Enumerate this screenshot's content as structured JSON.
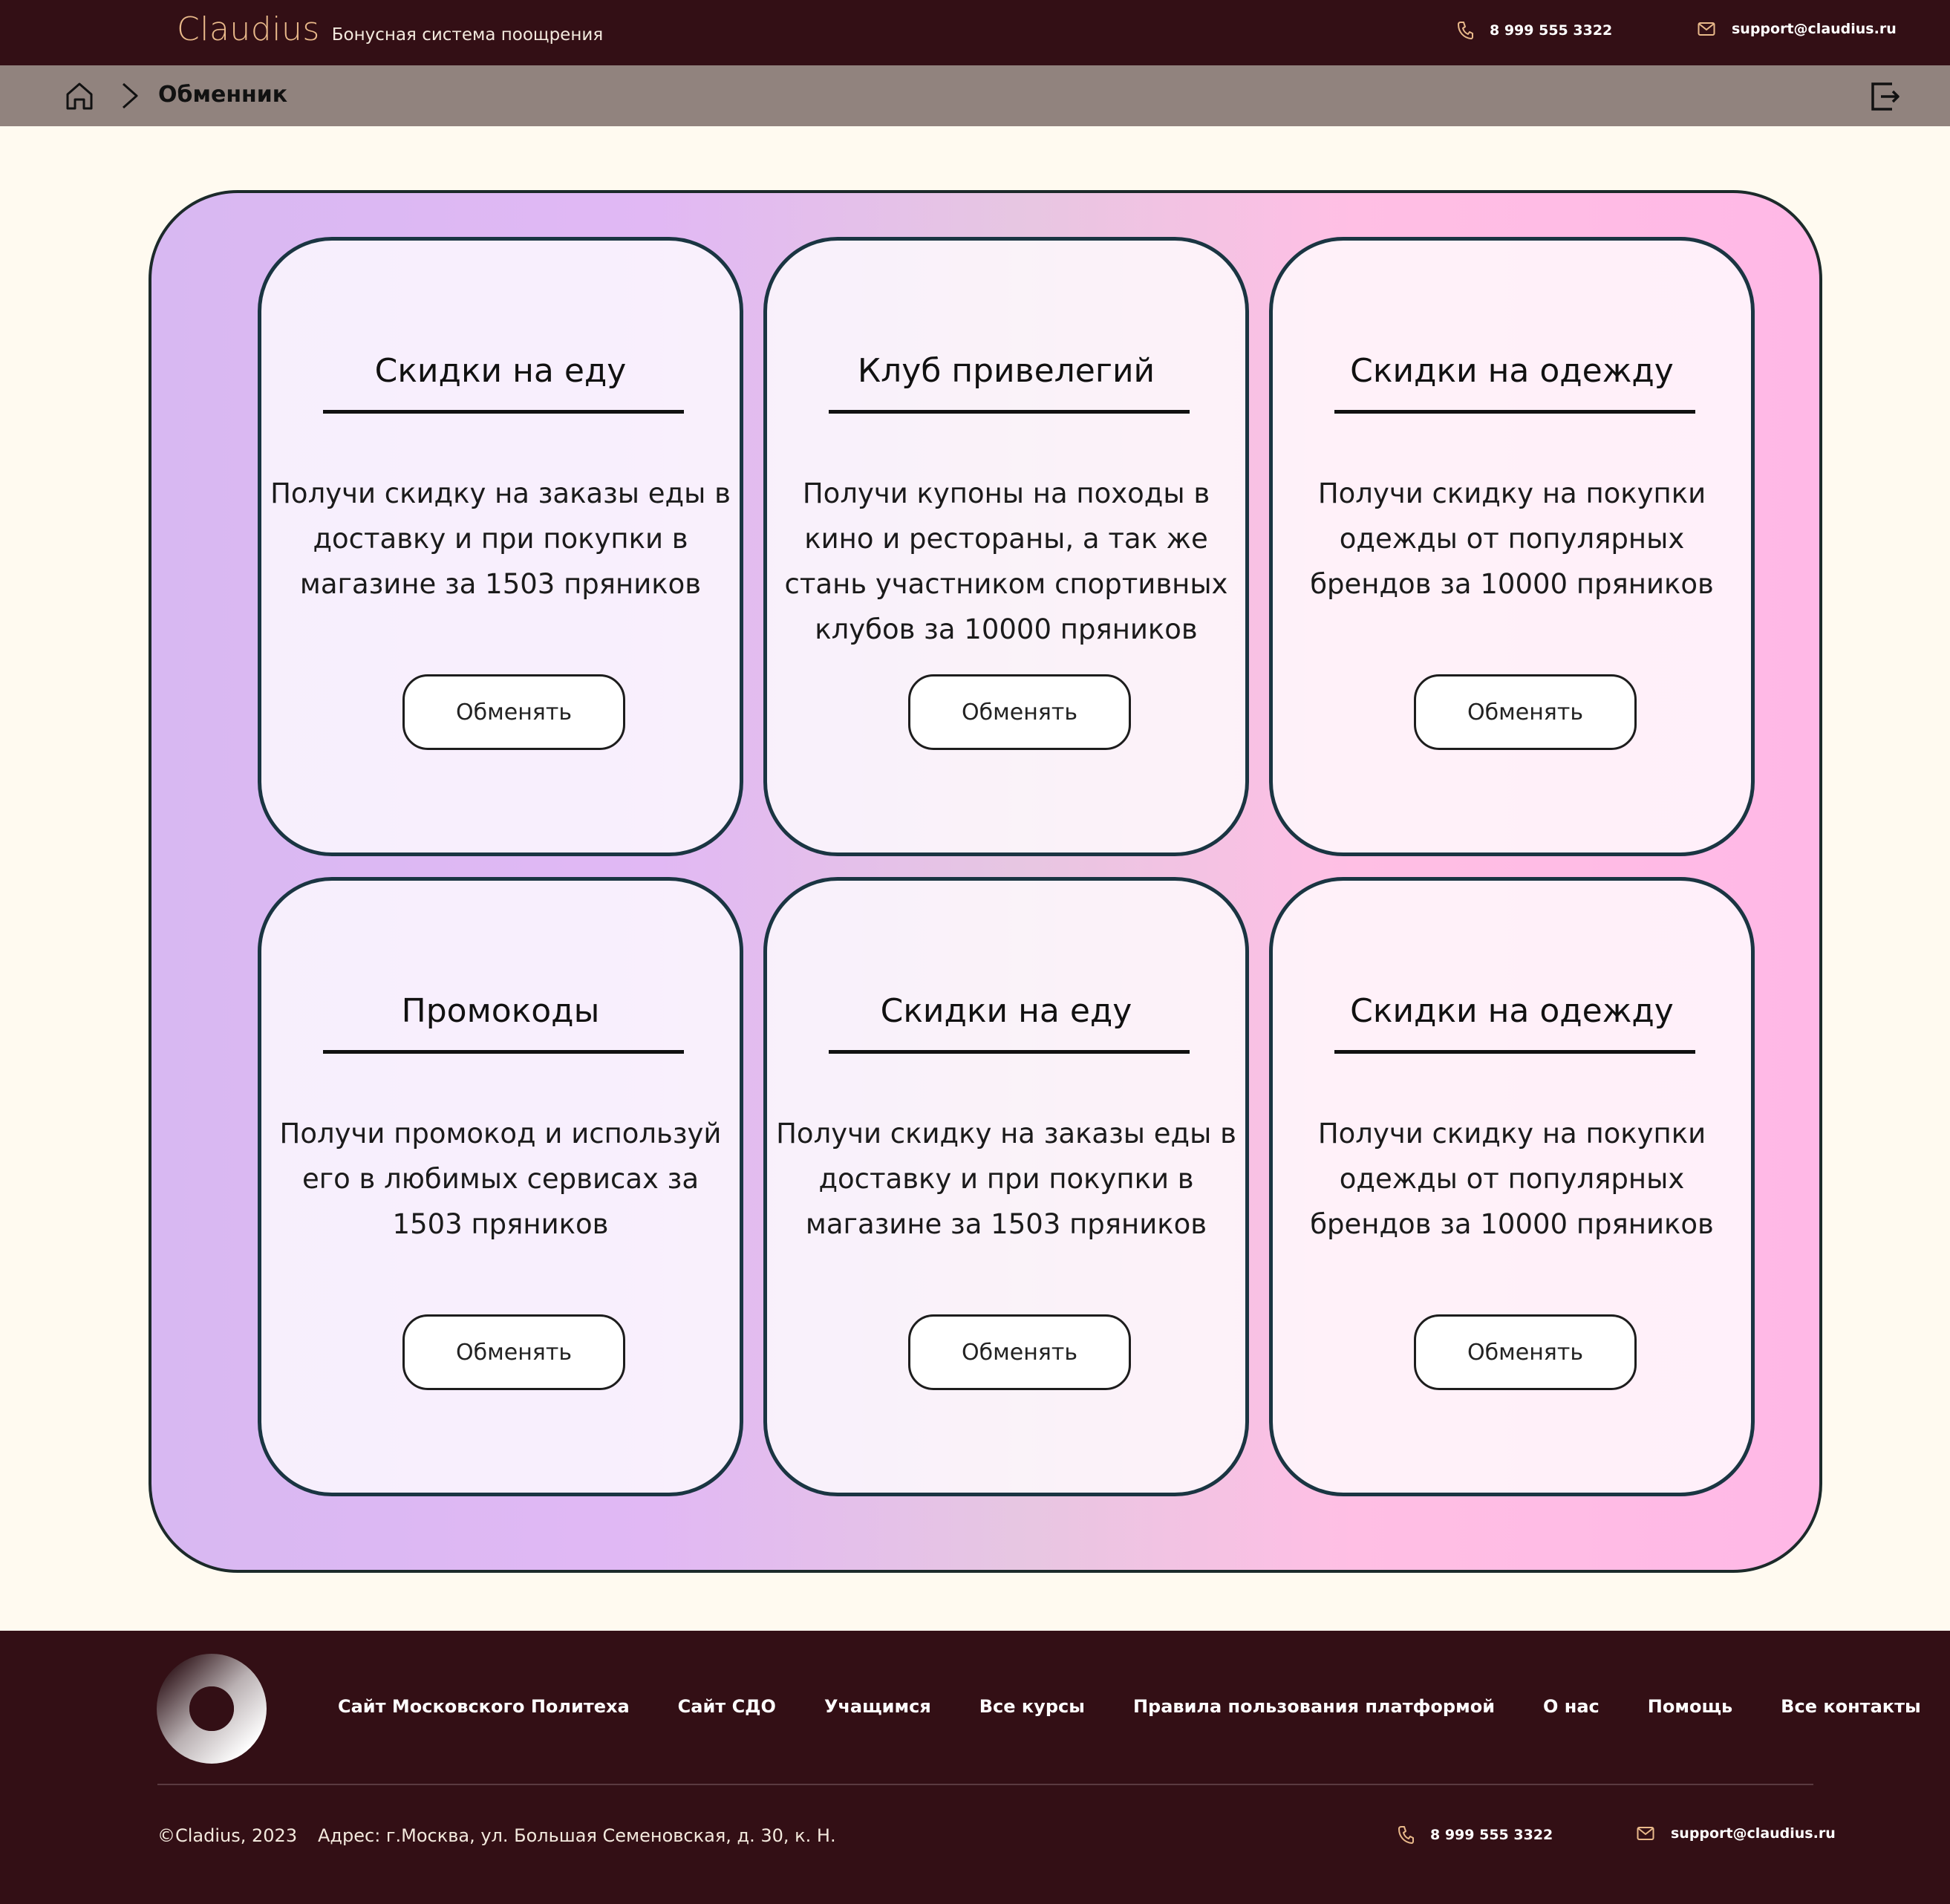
{
  "header": {
    "brand": "Claudius",
    "tagline": "Бонусная система поощрения",
    "phone": "8 999 555 3322",
    "email": "support@claudius.ru"
  },
  "breadcrumb": {
    "current": "Обменник"
  },
  "cards": [
    {
      "title": "Скидки на еду",
      "text": "Получи скидку на заказы еды в доставку и при покупки в магазине за 1503 пряников",
      "button": "Обменять"
    },
    {
      "title": "Клуб привелегий",
      "text": "Получи купоны на походы в кино и рестораны, а так же стань участником спортивных клубов за 10000 пряников",
      "button": "Обменять"
    },
    {
      "title": "Скидки на одежду",
      "text": "Получи скидку на покупки одежды от популярных брендов за 10000 пряников",
      "button": "Обменять"
    },
    {
      "title": "Промокоды",
      "text": "Получи промокод и используй его в любимых сервисах за 1503 пряников",
      "button": "Обменять"
    },
    {
      "title": "Скидки на еду",
      "text": "Получи скидку на заказы еды в доставку и при покупки в магазине за 1503 пряников",
      "button": "Обменять"
    },
    {
      "title": "Скидки на одежду",
      "text": "Получи скидку на покупки одежды от популярных брендов за 10000 пряников",
      "button": "Обменять"
    }
  ],
  "footer": {
    "nav": [
      "Сайт Московского Политеха",
      "Сайт СДО",
      "Учащимся",
      "Все курсы",
      "Правила пользования платформой",
      "О нас",
      "Помощь",
      "Все контакты"
    ],
    "copyright": "©Cladius, 2023",
    "address": "Адрес: г.Москва, ул. Большая Семеновская, д. 30, к. Н.",
    "phone": "8 999 555 3322",
    "email": "support@claudius.ru"
  },
  "colors": {
    "dark": "#330f15",
    "accent": "#e9b98a",
    "crumb_bar": "#91837e",
    "page_bg": "#fffaf0",
    "panel_left": "#d8b8f2",
    "panel_right": "#ffb8e6"
  },
  "icons": [
    "phone-icon",
    "mail-icon",
    "home-icon",
    "chevron-right-icon",
    "logout-icon",
    "ring-logo-icon"
  ]
}
